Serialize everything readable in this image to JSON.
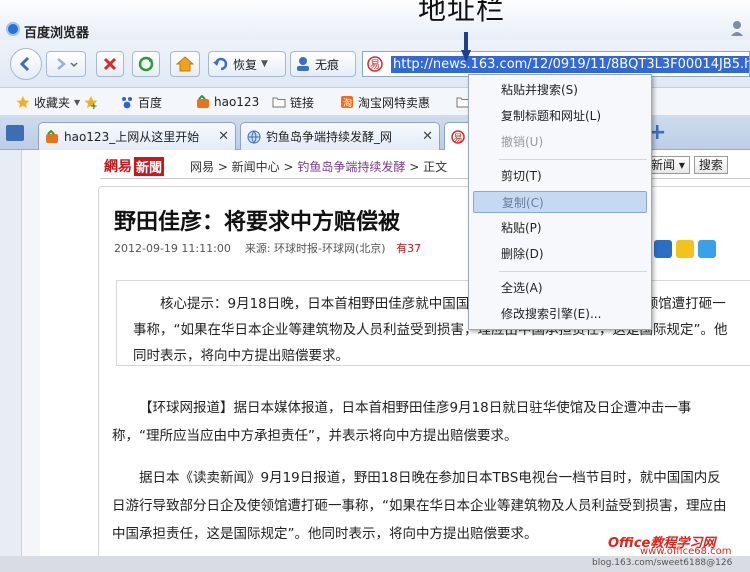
{
  "annotation": {
    "label": "地址栏"
  },
  "window": {
    "title": "百度浏览器"
  },
  "toolbar": {
    "restore_label": "恢复",
    "noscar_label": "无痕"
  },
  "address": {
    "url": "http://news.163.com/12/0919/11/8BQT3L3F00014JB5.html"
  },
  "bookmarks": {
    "favorites": "收藏夹",
    "items": [
      "百度",
      "hao123",
      "链接",
      "淘宝网特卖惠"
    ]
  },
  "tabs": [
    "hao123_上网从这里开始",
    "钓鱼岛争端持续发酵_网"
  ],
  "page": {
    "logo_part1": "網易",
    "logo_part2": "新聞",
    "breadcrumb_a": "网易 > 新闻中心 > ",
    "breadcrumb_b": "钓鱼岛争端持续发酵",
    "breadcrumb_c": " > 正文",
    "search_select": "新闻",
    "search_button": "搜索",
    "headline": "野田佳彦：将要求中方赔偿被",
    "meta_date": "2012-09-19 11:11:00",
    "meta_source": "来源: 环球时报-环球网(北京)",
    "meta_count": "有37",
    "summary": "核心提示：9月18日晚，日本首相野田佳彦就中国国内反日游行导致部分日企及使领馆遭打砸一事称，“如果在华日本企业等建筑物及人员利益受到损害，理应由中国承担责任，这是国际规定”。他同时表示，将向中方提出赔偿要求。",
    "para1": "【环球网报道】据日本媒体报道，日本首相野田佳彦9月18日就日驻华使馆及日企遭冲击一事称，“理所应当应由中方承担责任”，并表示将向中方提出赔偿要求。",
    "para2": "据日本《读卖新闻》9月19日报道，野田18日晚在参加日本TBS电视台一档节目时，就中国国内反日游行导致部分日企及使领馆遭打砸一事称，“如果在华日本企业等建筑物及人员利益受到损害，理应由中国承担责任，这是国际规定”。他同时表示，将向中方提出赔偿要求。"
  },
  "context_menu": {
    "paste_search": "粘贴并搜索(S)",
    "copy_title_url": "复制标题和网址(L)",
    "undo": "撤销(U)",
    "cut": "剪切(T)",
    "copy": "复制(C)",
    "paste": "粘贴(P)",
    "delete": "删除(D)",
    "select_all": "全选(A)",
    "change_engine": "修改搜索引擎(E)..."
  },
  "watermark": {
    "site": "Office教程学习网",
    "url": "www.office68.com",
    "blog": "blog.163.com/sweet6188@126"
  },
  "colors": {
    "selection": "#3369d6",
    "netease_red": "#c8161d",
    "watermark_red": "#e2231a"
  }
}
